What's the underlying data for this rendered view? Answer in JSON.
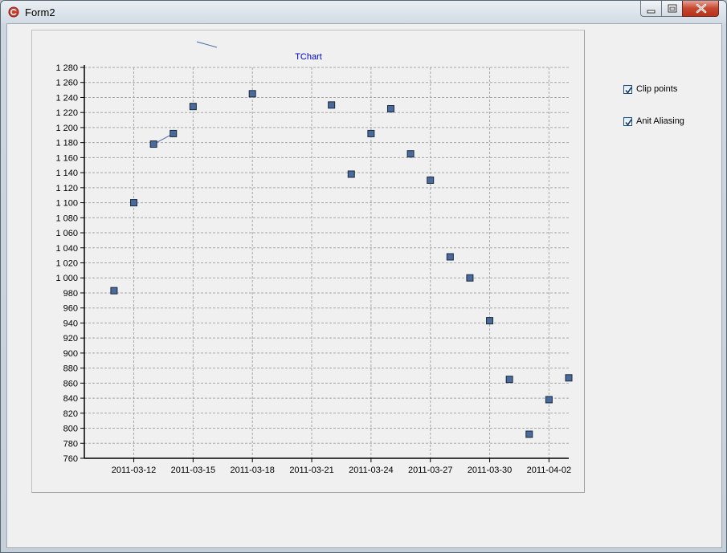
{
  "window": {
    "title": "Form2"
  },
  "controls": {
    "clip_points": {
      "label": "Clip points",
      "checked": true
    },
    "anti_aliasing": {
      "label": "Anit Aliasing",
      "checked": true
    }
  },
  "colors": {
    "point_fill": "#4a6a9a",
    "point_stroke": "#1a2a40",
    "grid": "#a8a8a8",
    "title": "#0000cc",
    "line": "#4a6aa8"
  },
  "chart_data": {
    "type": "scatter",
    "title": "TChart",
    "xlabel": "",
    "ylabel": "",
    "ylim": [
      760,
      1280
    ],
    "xlim": [
      "2011-03-09T12:00",
      "2011-04-03T00:00"
    ],
    "yticks": [
      760,
      780,
      800,
      820,
      840,
      860,
      880,
      900,
      920,
      940,
      960,
      980,
      1000,
      1020,
      1040,
      1060,
      1080,
      1100,
      1120,
      1140,
      1160,
      1180,
      1200,
      1220,
      1240,
      1260,
      1280
    ],
    "ytick_labels": [
      "760",
      "780",
      "800",
      "820",
      "840",
      "860",
      "880",
      "900",
      "920",
      "940",
      "960",
      "980",
      "1 000",
      "1 020",
      "1 040",
      "1 060",
      "1 080",
      "1 100",
      "1 120",
      "1 140",
      "1 160",
      "1 180",
      "1 200",
      "1 220",
      "1 240",
      "1 260",
      "1 280"
    ],
    "xticks": [
      "2011-03-12",
      "2011-03-15",
      "2011-03-18",
      "2011-03-21",
      "2011-03-24",
      "2011-03-27",
      "2011-03-30",
      "2011-04-02"
    ],
    "grid": true,
    "legend": "none",
    "series": [
      {
        "points": [
          {
            "x": "2011-03-11",
            "y": 983
          },
          {
            "x": "2011-03-12",
            "y": 1100
          },
          {
            "x": "2011-03-13",
            "y": 1178
          },
          {
            "x": "2011-03-14",
            "y": 1192
          },
          {
            "x": "2011-03-15",
            "y": 1228
          },
          {
            "x": "2011-03-18",
            "y": 1245
          },
          {
            "x": "2011-03-22",
            "y": 1230
          },
          {
            "x": "2011-03-23",
            "y": 1138
          },
          {
            "x": "2011-03-24",
            "y": 1192
          },
          {
            "x": "2011-03-25",
            "y": 1225
          },
          {
            "x": "2011-03-26",
            "y": 1165
          },
          {
            "x": "2011-03-27",
            "y": 1130
          },
          {
            "x": "2011-03-28",
            "y": 1028
          },
          {
            "x": "2011-03-29",
            "y": 1000
          },
          {
            "x": "2011-03-30",
            "y": 943
          },
          {
            "x": "2011-03-31",
            "y": 865
          },
          {
            "x": "2011-04-01",
            "y": 792
          },
          {
            "x": "2011-04-02",
            "y": 838
          },
          {
            "x": "2011-04-03",
            "y": 867
          }
        ]
      }
    ]
  }
}
